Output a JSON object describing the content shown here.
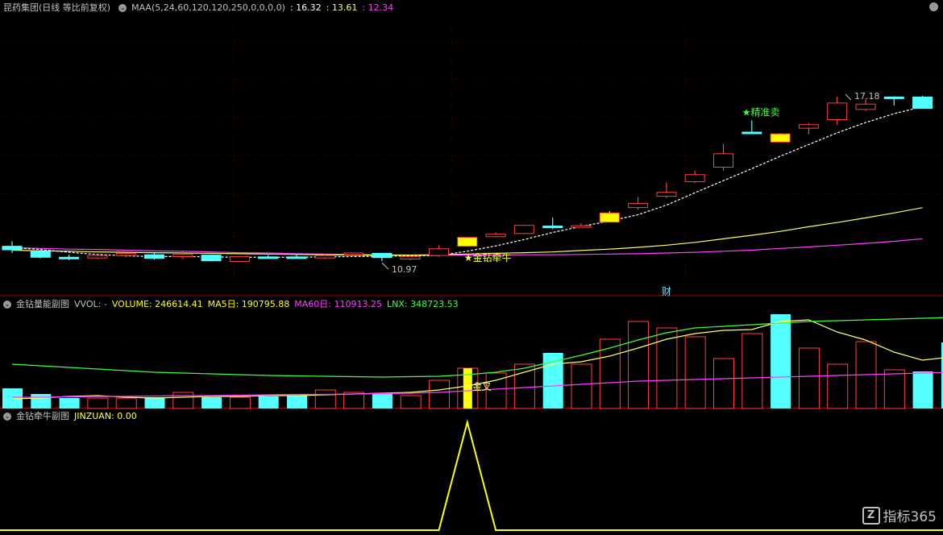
{
  "main_header": {
    "title": "昆药集团(日线 等比前复权)",
    "indicator": "MAA(5,24,60,120,120,250,0,0,0,0)",
    "v1": ": 16.32",
    "v2": ": 13.61",
    "v3": ": 12.34",
    "colors": {
      "v1": "#ffffff",
      "v2": "#ffff66",
      "v3": "#ff40ff"
    }
  },
  "vol_header": {
    "title": "金钻量能副图",
    "vvol": "VVOL: -",
    "volume": "VOLUME: 246614.41",
    "ma5": "MA5日: 190795.88",
    "ma60": "MA60日: 110913.25",
    "lnx": "LNX: 348723.53",
    "colors": {
      "volume": "#ffff00",
      "ma5": "#ffff00",
      "ma60": "#ff40ff",
      "lnx": "#40ff40"
    }
  },
  "jz_header": {
    "title": "金钻牵牛副图",
    "value": "JINZUAN: 0.00"
  },
  "watermark": {
    "logo": "Z",
    "text": "指标365"
  },
  "chart_data": [
    {
      "type": "candlestick",
      "panel": "price",
      "ylim": [
        10.2,
        17.7
      ],
      "colors": {
        "up": "#ff4040",
        "down": "#54ffff",
        "signal": "#ffff00",
        "ma_white": "#ffffff",
        "ma_yellow": "#ffff66",
        "ma_magenta": "#ff40ff"
      },
      "candles": [
        {
          "o": 11.39,
          "h": 11.53,
          "l": 11.2,
          "c": 11.29,
          "dir": "down"
        },
        {
          "o": 11.24,
          "h": 11.24,
          "l": 11.05,
          "c": 11.08,
          "dir": "down"
        },
        {
          "o": 11.08,
          "h": 11.15,
          "l": 11.0,
          "c": 11.05,
          "dir": "down"
        },
        {
          "o": 11.06,
          "h": 11.16,
          "l": 11.03,
          "c": 11.13,
          "dir": "up"
        },
        {
          "o": 11.13,
          "h": 11.2,
          "l": 11.08,
          "c": 11.19,
          "dir": "up"
        },
        {
          "o": 11.15,
          "h": 11.2,
          "l": 11.01,
          "c": 11.05,
          "dir": "down"
        },
        {
          "o": 11.1,
          "h": 11.27,
          "l": 11.03,
          "c": 11.16,
          "dir": "up"
        },
        {
          "o": 11.14,
          "h": 11.16,
          "l": 10.96,
          "c": 10.98,
          "dir": "down"
        },
        {
          "o": 10.96,
          "h": 11.11,
          "l": 10.95,
          "c": 11.1,
          "dir": "up"
        },
        {
          "o": 11.09,
          "h": 11.14,
          "l": 11.04,
          "c": 11.07,
          "dir": "down"
        },
        {
          "o": 11.09,
          "h": 11.16,
          "l": 11.03,
          "c": 11.06,
          "dir": "down"
        },
        {
          "o": 11.06,
          "h": 11.16,
          "l": 11.03,
          "c": 11.13,
          "dir": "up"
        },
        {
          "o": 11.15,
          "h": 11.21,
          "l": 11.11,
          "c": 11.2,
          "dir": "up"
        },
        {
          "o": 11.19,
          "h": 11.21,
          "l": 10.97,
          "c": 11.07,
          "dir": "down"
        },
        {
          "o": 11.03,
          "h": 11.14,
          "l": 11.0,
          "c": 11.1,
          "dir": "up"
        },
        {
          "o": 11.13,
          "h": 11.42,
          "l": 11.1,
          "c": 11.32,
          "dir": "up"
        },
        {
          "o": 11.39,
          "h": 11.64,
          "l": 11.38,
          "c": 11.64,
          "dir": "signal"
        },
        {
          "o": 11.66,
          "h": 11.78,
          "l": 11.65,
          "c": 11.73,
          "dir": "up"
        },
        {
          "o": 11.75,
          "h": 12.0,
          "l": 11.73,
          "c": 11.98,
          "dir": "up"
        },
        {
          "o": 11.96,
          "h": 12.2,
          "l": 11.87,
          "c": 11.96,
          "dir": "down"
        },
        {
          "o": 11.94,
          "h": 12.04,
          "l": 11.92,
          "c": 11.97,
          "dir": "up"
        },
        {
          "o": 12.07,
          "h": 12.38,
          "l": 12.07,
          "c": 12.33,
          "dir": "signal"
        },
        {
          "o": 12.48,
          "h": 12.78,
          "l": 12.42,
          "c": 12.6,
          "dir": "up"
        },
        {
          "o": 12.8,
          "h": 13.19,
          "l": 12.75,
          "c": 12.91,
          "dir": "up"
        },
        {
          "o": 13.21,
          "h": 13.52,
          "l": 13.17,
          "c": 13.41,
          "dir": "up"
        },
        {
          "o": 13.62,
          "h": 14.28,
          "l": 13.52,
          "c": 14.0,
          "dir": "up"
        },
        {
          "o": 14.59,
          "h": 14.94,
          "l": 14.59,
          "c": 14.61,
          "dir": "down"
        },
        {
          "o": 14.33,
          "h": 14.58,
          "l": 14.33,
          "c": 14.56,
          "dir": "signal"
        },
        {
          "o": 14.72,
          "h": 14.87,
          "l": 14.55,
          "c": 14.82,
          "dir": "up"
        },
        {
          "o": 14.96,
          "h": 15.61,
          "l": 14.82,
          "c": 15.43,
          "dir": "up"
        },
        {
          "o": 15.25,
          "h": 15.56,
          "l": 15.21,
          "c": 15.4,
          "dir": "up"
        },
        {
          "o": 15.6,
          "h": 15.62,
          "l": 15.36,
          "c": 15.6,
          "dir": "down"
        },
        {
          "o": 15.28,
          "h": 15.63,
          "l": 15.28,
          "c": 15.6,
          "dir": "down"
        }
      ],
      "ma_white": [
        11.35,
        11.3,
        11.22,
        11.16,
        11.12,
        11.1,
        11.1,
        11.09,
        11.08,
        11.08,
        11.08,
        11.09,
        11.1,
        11.11,
        11.12,
        11.13,
        11.25,
        11.4,
        11.58,
        11.78,
        11.95,
        12.1,
        12.28,
        12.55,
        12.9,
        13.24,
        13.58,
        13.93,
        14.26,
        14.59,
        14.88,
        15.13,
        15.33
      ],
      "ma_yellow": [
        11.28,
        11.26,
        11.25,
        11.23,
        11.22,
        11.21,
        11.2,
        11.19,
        11.18,
        11.17,
        11.16,
        11.15,
        11.14,
        11.14,
        11.14,
        11.15,
        11.17,
        11.19,
        11.21,
        11.23,
        11.27,
        11.31,
        11.36,
        11.42,
        11.5,
        11.6,
        11.7,
        11.81,
        11.94,
        12.06,
        12.19,
        12.33,
        12.48
      ],
      "ma_magenta": [
        11.35,
        11.33,
        11.31,
        11.3,
        11.28,
        11.26,
        11.25,
        11.23,
        11.21,
        11.2,
        11.18,
        11.17,
        11.16,
        11.15,
        11.14,
        11.14,
        11.14,
        11.14,
        11.15,
        11.15,
        11.16,
        11.17,
        11.18,
        11.2,
        11.22,
        11.25,
        11.28,
        11.33,
        11.37,
        11.42,
        11.47,
        11.53,
        11.6
      ],
      "annotations": [
        {
          "candle": 13,
          "text": "10.97",
          "kind": "low",
          "color": "#c0c0c0"
        },
        {
          "candle": 16,
          "text": "★金钻牵牛",
          "kind": "signal",
          "color": "#ffff40"
        },
        {
          "candle": 26,
          "text": "★精准卖",
          "kind": "sell",
          "color": "#40ff40"
        },
        {
          "candle": 30,
          "text": "17.18",
          "kind": "high",
          "color": "#c0c0c0"
        },
        {
          "candle": 23,
          "text": "财",
          "kind": "axis-mark",
          "color": "#6ee0ff"
        }
      ]
    },
    {
      "type": "bar",
      "panel": "volume",
      "ylim": [
        0,
        125000
      ],
      "values": [
        25000,
        18000,
        13000,
        13000,
        13000,
        14000,
        20000,
        14000,
        14000,
        15000,
        16000,
        23000,
        20000,
        19000,
        16000,
        35000,
        50000,
        44000,
        55000,
        69000,
        55000,
        86000,
        108000,
        100000,
        89000,
        62000,
        93000,
        117000,
        75000,
        55000,
        83000,
        48000,
        46000,
        82000
      ],
      "colors_dir": [
        "down",
        "down",
        "down",
        "up",
        "up",
        "down",
        "up",
        "down",
        "up",
        "down",
        "down",
        "up",
        "up",
        "down",
        "up",
        "up",
        "signal",
        "up",
        "up",
        "down",
        "up",
        "up",
        "up",
        "up",
        "up",
        "up",
        "up",
        "down",
        "up",
        "up",
        "up",
        "up",
        "down",
        "down"
      ],
      "series": [
        {
          "name": "MA5日",
          "color": "#ffff66",
          "values": [
            12000,
            13000,
            15000,
            16000,
            14000,
            13000,
            14000,
            15000,
            15000,
            16000,
            16000,
            17000,
            18000,
            19000,
            20000,
            23000,
            28000,
            35000,
            45000,
            55000,
            58000,
            65000,
            75000,
            86000,
            93000,
            97000,
            98000,
            108000,
            110000,
            95000,
            85000,
            70000,
            60000,
            64000
          ]
        },
        {
          "name": "MA60日",
          "color": "#ff40ff",
          "values": [
            14000,
            14000,
            14500,
            15000,
            15000,
            15500,
            16000,
            16000,
            16500,
            17000,
            17500,
            17500,
            18000,
            18500,
            19000,
            20000,
            22000,
            24000,
            26000,
            28000,
            30000,
            32000,
            34000,
            35000,
            36000,
            37000,
            38000,
            39000,
            40000,
            41000,
            42000,
            43000,
            44000,
            45000
          ]
        },
        {
          "name": "LNX",
          "color": "#40ff40",
          "values": [
            55000,
            53000,
            51000,
            49000,
            47000,
            45000,
            44000,
            43000,
            42000,
            41000,
            40500,
            40000,
            39500,
            39000,
            39500,
            40000,
            42000,
            45000,
            50000,
            58000,
            66000,
            75000,
            85000,
            94000,
            100000,
            102000,
            104000,
            106000,
            108000,
            109000,
            110000,
            111000,
            112000,
            113000
          ]
        }
      ],
      "annotation": {
        "bar": 16,
        "text": "金叉",
        "color": "#ffff66"
      }
    },
    {
      "type": "line",
      "panel": "jinzuan",
      "ylim": [
        0,
        1
      ],
      "values": [
        0,
        0,
        0,
        0,
        0,
        0,
        0,
        0,
        0,
        0,
        0,
        0,
        0,
        0,
        0,
        0,
        1,
        0,
        0,
        0,
        0,
        0,
        0,
        0,
        0,
        0,
        0,
        0,
        0,
        0,
        0,
        0,
        0,
        0
      ],
      "color": "#ffff00"
    }
  ]
}
